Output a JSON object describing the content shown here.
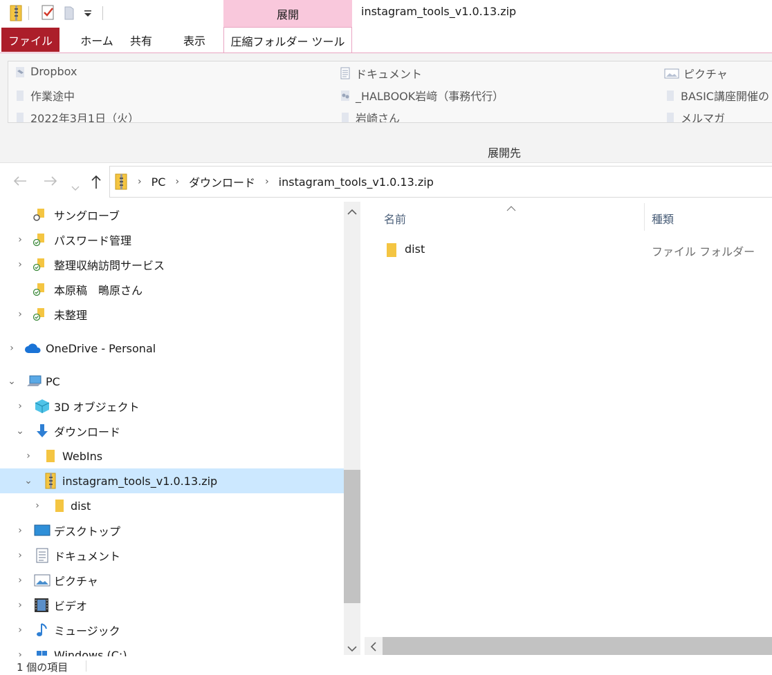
{
  "window": {
    "title": "instagram_tools_v1.0.13.zip",
    "context_tab_header": "展開"
  },
  "ribbon": {
    "tabs": {
      "file": "ファイル",
      "home": "ホーム",
      "share": "共有",
      "view": "表示",
      "tools": "圧縮フォルダー ツール"
    },
    "destinations": [
      {
        "label": "Dropbox",
        "icon": "dropbox-icon"
      },
      {
        "label": "作業途中",
        "icon": "folder-icon"
      },
      {
        "label": "2022年3月1日（火）",
        "icon": "folder-icon"
      },
      {
        "label": "ドキュメント",
        "icon": "document-icon"
      },
      {
        "label": "_HALBOOK岩﨑（事務代行）",
        "icon": "shared-folder-icon"
      },
      {
        "label": "岩崎さん",
        "icon": "folder-icon"
      },
      {
        "label": "ピクチャ",
        "icon": "pictures-icon"
      },
      {
        "label": "BASIC講座開催の",
        "icon": "folder-icon"
      },
      {
        "label": "メルマガ",
        "icon": "folder-icon"
      }
    ],
    "group_label": "展開先"
  },
  "address": {
    "crumbs": [
      "PC",
      "ダウンロード",
      "instagram_tools_v1.0.13.zip"
    ]
  },
  "tree": [
    {
      "label": "サングローブ",
      "icon": "shared-folder-icon",
      "expander": ""
    },
    {
      "label": "パスワード管理",
      "icon": "synced-folder-icon",
      "expander": "›"
    },
    {
      "label": "整理収納訪問サービス",
      "icon": "synced-folder-icon",
      "expander": "›"
    },
    {
      "label": "本原稿　鴫原さん",
      "icon": "synced-folder-icon",
      "expander": ""
    },
    {
      "label": "未整理",
      "icon": "synced-folder-icon",
      "expander": "›"
    },
    {
      "label": "OneDrive - Personal",
      "icon": "onedrive-icon",
      "expander": "›"
    },
    {
      "label": "PC",
      "icon": "pc-icon",
      "expander": "⌄"
    },
    {
      "label": "3D オブジェクト",
      "icon": "3d-objects-icon",
      "expander": "›"
    },
    {
      "label": "ダウンロード",
      "icon": "downloads-icon",
      "expander": "⌄"
    },
    {
      "label": "WebIns",
      "icon": "folder-icon",
      "expander": "›"
    },
    {
      "label": "instagram_tools_v1.0.13.zip",
      "icon": "zip-folder-icon",
      "expander": "⌄"
    },
    {
      "label": "dist",
      "icon": "folder-icon",
      "expander": "›"
    },
    {
      "label": "デスクトップ",
      "icon": "desktop-icon",
      "expander": "›"
    },
    {
      "label": "ドキュメント",
      "icon": "document-icon",
      "expander": "›"
    },
    {
      "label": "ピクチャ",
      "icon": "pictures-icon",
      "expander": "›"
    },
    {
      "label": "ビデオ",
      "icon": "videos-icon",
      "expander": "›"
    },
    {
      "label": "ミュージック",
      "icon": "music-icon",
      "expander": "›"
    },
    {
      "label": "Windows (C:)",
      "icon": "drive-icon",
      "expander": "›"
    }
  ],
  "list": {
    "columns": {
      "name": "名前",
      "type": "種類"
    },
    "rows": [
      {
        "name": "dist",
        "type": "ファイル フォルダー",
        "icon": "folder-icon"
      }
    ]
  },
  "status": {
    "count": "1 個の項目"
  },
  "colors": {
    "file_tab": "#ac1e2a",
    "context_tab": "#f9c8dc",
    "selection": "#cce8ff",
    "folder": "#f4c542"
  }
}
